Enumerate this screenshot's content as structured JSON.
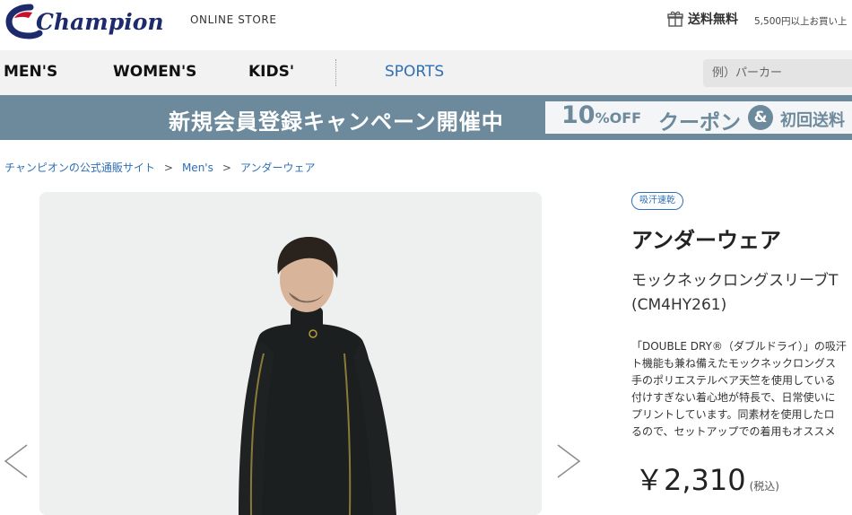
{
  "header": {
    "logo_text": "Champion",
    "store_label": "ONLINE STORE",
    "shipping_bold": "送料無料",
    "shipping_note": "5,500円以上お買い上"
  },
  "nav": {
    "items": [
      "MEN'S",
      "WOMEN'S",
      "KIDS'",
      "SPORTS"
    ],
    "search_placeholder": "例）パーカー"
  },
  "banner": {
    "main": "新規会員登録キャンペーン開催中",
    "pct": "10",
    "pct_unit": "%OFF",
    "coupon": "クーポン",
    "amp": "&",
    "first": "初回送料"
  },
  "breadcrumb": [
    "チャンピオンの公式通販サイト",
    "Men's",
    "アンダーウェア"
  ],
  "product": {
    "tag": "吸汗速乾",
    "category": "アンダーウェア",
    "name_line1": "モックネックロングスリーブT",
    "name_line2": "(CM4HY261)",
    "description_lines": [
      "「DOUBLE DRY®（ダブルドライ）」の吸汗",
      "ト機能も兼ね備えたモックネックロングス",
      "手のポリエステルベア天竺を使用している",
      "付けすぎない着心地が特長で、日常使いに",
      "プリントしています。同素材を使用したロ",
      "るので、セットアップでの着用もオススメ"
    ],
    "price": "￥2,310",
    "tax_note": "(税込)"
  },
  "colors": {
    "brand_navy": "#1d2a6b",
    "brand_red": "#c8102e",
    "link_blue": "#2f6fb5",
    "banner_bg": "#6d8a9c"
  },
  "icons": [
    "gift-icon",
    "chevron-left-icon",
    "chevron-right-icon"
  ]
}
